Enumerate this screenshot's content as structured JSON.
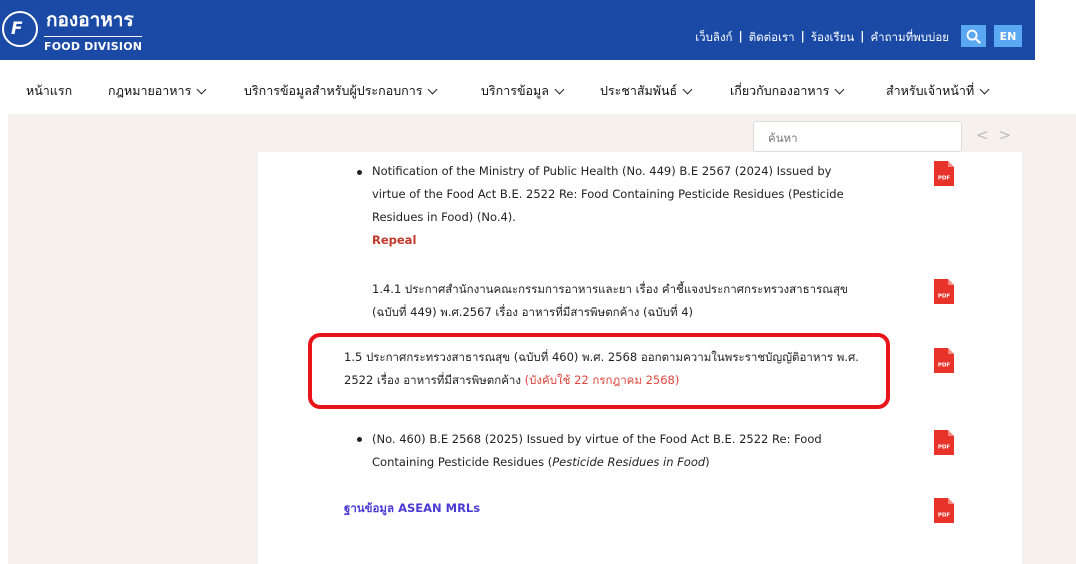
{
  "header": {
    "logo_th": "กองอาหาร",
    "logo_en": "FOOD DIVISION",
    "links": [
      "เว็บลิงก์",
      "ติดต่อเรา",
      "ร้องเรียน",
      "คำถามที่พบบ่อย"
    ],
    "separator": "|",
    "lang": "EN"
  },
  "nav": {
    "items": [
      {
        "label": "หน้าแรก"
      },
      {
        "label": "กฎหมายอาหาร"
      },
      {
        "label": "บริการข้อมูลสำหรับผู้ประกอบการ"
      },
      {
        "label": "บริการข้อมูล"
      },
      {
        "label": "ประชาสัมพันธ์"
      },
      {
        "label": "เกี่ยวกับกองอาหาร"
      },
      {
        "label": "สำหรับเจ้าหน้าที่"
      }
    ]
  },
  "search": {
    "placeholder": "ค้นหา"
  },
  "pager": {
    "prev": "<",
    "next": ">"
  },
  "content": {
    "item1": {
      "line1": "Notification of the Ministry of Public Health (No. 449) B.E 2567 (2024) Issued by",
      "line2": "virtue of the Food Act B.E. 2522 Re: Food Containing Pesticide Residues (Pesticide",
      "line3": "Residues in Food) (No.4).",
      "status": "Repeal"
    },
    "item2": {
      "line1": "1.4.1 ประกาศสำนักงานคณะกรรมการอาหารและยา เรื่อง คำชี้แจงประกาศกระทรวงสาธารณสุข",
      "line2": "(ฉบับที่ 449) พ.ศ.2567 เรื่อง อาหารที่มีสารพิษตกค้าง (ฉบับที่ 4)"
    },
    "item3": {
      "line1": "1.5 ประกาศกระทรวงสาธารณสุข (ฉบับที่ 460) พ.ศ. 2568 ออกตามความในพระราชบัญญัติอาหาร พ.ศ.",
      "line2": "2522 เรื่อง อาหารที่มีสารพิษตกค้าง",
      "effective": "(บังคับใช้ 22 กรกฎาคม 2568)"
    },
    "item4": {
      "line1": "(No. 460) B.E 2568 (2025) Issued by virtue of the Food Act B.E. 2522 Re: Food",
      "line2a": "Containing Pesticide Residues (",
      "line2b": "Pesticide Residues in Food",
      "line2c": ")"
    },
    "asean": "ฐานข้อมูล ASEAN MRLs",
    "pdf_label": "PDF"
  },
  "colors": {
    "header_bg": "#1a4aa6",
    "accent": "#5aa7f2",
    "highlight": "#e8141a",
    "link": "#4b3bd6",
    "pdf": "#e8332a"
  }
}
